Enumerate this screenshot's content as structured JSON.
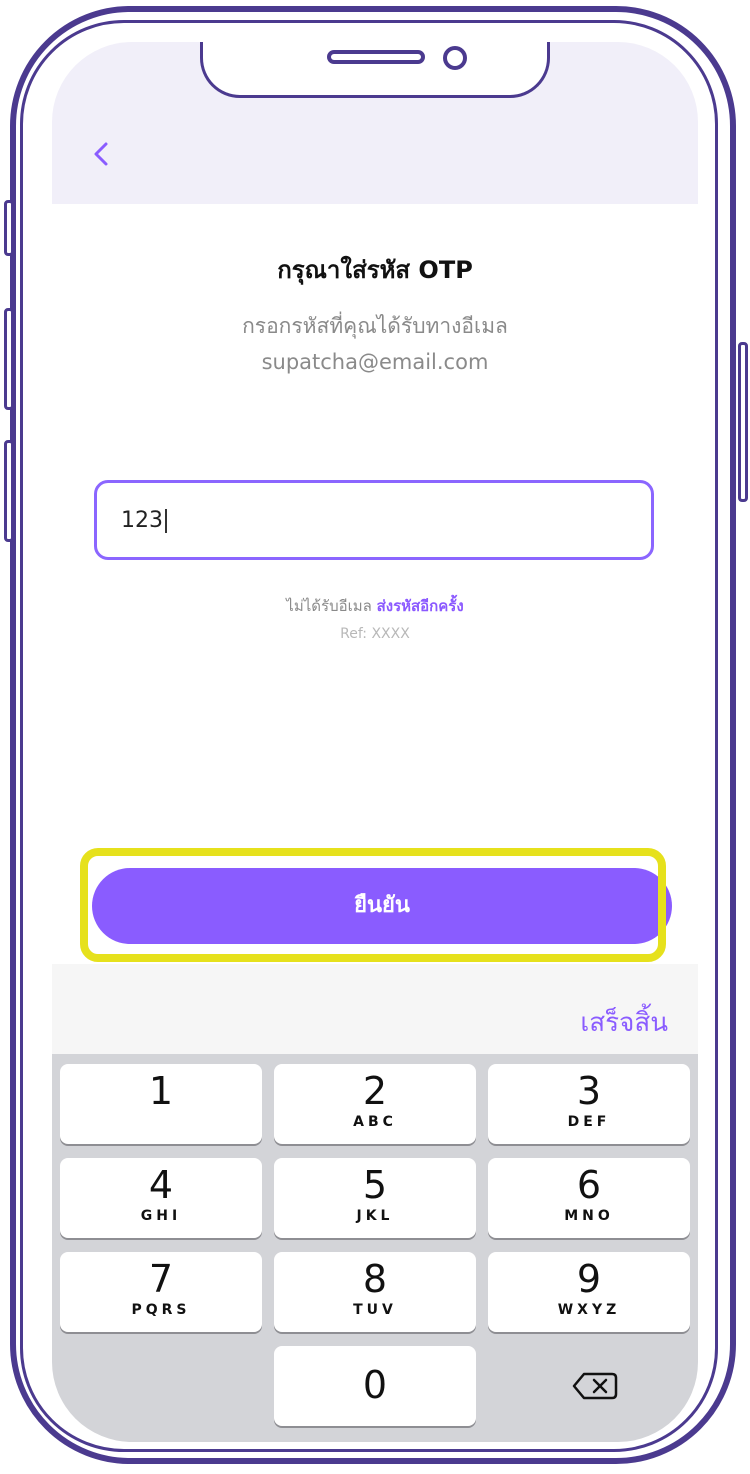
{
  "header": {
    "back_icon": "chevron-left-icon"
  },
  "otp": {
    "title": "กรุณาใส่รหัส OTP",
    "instruction": "กรอกรหัสที่คุณได้รับทางอีเมล",
    "email": "supatcha@email.com",
    "input_value": "123"
  },
  "resend": {
    "prefix": "ไม่ได้รับอีเมล",
    "link": "ส่งรหัสอีกครั้ง",
    "ref": "Ref: XXXX"
  },
  "confirm_label": "ยืนยัน",
  "keyboard": {
    "done_label": "เสร็จสิ้น",
    "keys": [
      {
        "num": "1",
        "letters": ""
      },
      {
        "num": "2",
        "letters": "ABC"
      },
      {
        "num": "3",
        "letters": "DEF"
      },
      {
        "num": "4",
        "letters": "GHI"
      },
      {
        "num": "5",
        "letters": "JKL"
      },
      {
        "num": "6",
        "letters": "MNO"
      },
      {
        "num": "7",
        "letters": "PQRS"
      },
      {
        "num": "8",
        "letters": "TUV"
      },
      {
        "num": "9",
        "letters": "WXYZ"
      },
      {
        "num": "0",
        "letters": ""
      }
    ],
    "backspace_icon": "backspace-icon"
  },
  "colors": {
    "accent": "#8a5cff",
    "frame": "#4b3a8f",
    "highlight": "#e6e11c"
  }
}
